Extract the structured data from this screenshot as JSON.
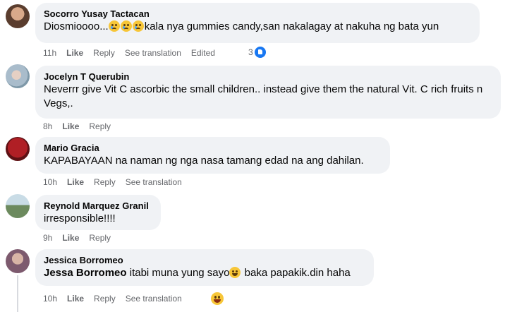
{
  "comments": [
    {
      "author": "Socorro Yusay Tactacan",
      "text_pre": "Diosmioooo...",
      "text_post": "kala nya gummies candy,san nakalagay at nakuha ng bata yun",
      "emoji": [
        "crying-face",
        "crying-face",
        "crying-face"
      ],
      "time": "11h",
      "like": "Like",
      "reply": "Reply",
      "translate": "See translation",
      "edited": "Edited",
      "reactions": "3",
      "avatar_color": "#8a6b5a"
    },
    {
      "author": "Jocelyn T Querubin",
      "text": "Neverrr give Vit C ascorbic the small children.. instead give them the natural Vit. C rich fruits n Vegs,.",
      "time": "8h",
      "like": "Like",
      "reply": "Reply",
      "avatar_color": "#b7c7d1"
    },
    {
      "author": "Mario Gracia",
      "text": "KAPABAYAAN na naman ng nga nasa tamang edad na ang dahilan.",
      "time": "10h",
      "like": "Like",
      "reply": "Reply",
      "translate": "See translation",
      "avatar_color": "#c3262b"
    },
    {
      "author": "Reynold Marquez Granil",
      "text": "irresponsible!!!!",
      "time": "9h",
      "like": "Like",
      "reply": "Reply",
      "avatar_color": "#6f8a6a"
    },
    {
      "author": "Jessica Borromeo",
      "mention": "Jessa Borromeo",
      "text_pre": " itabi muna yung sayo",
      "text_post": " baka papakik.din haha",
      "emoji": [
        "grinning-face"
      ],
      "time": "10h",
      "like": "Like",
      "reply": "Reply",
      "translate": "See translation",
      "reaction_emoji": "laughing-face",
      "avatar_color": "#9d7a8f"
    }
  ]
}
